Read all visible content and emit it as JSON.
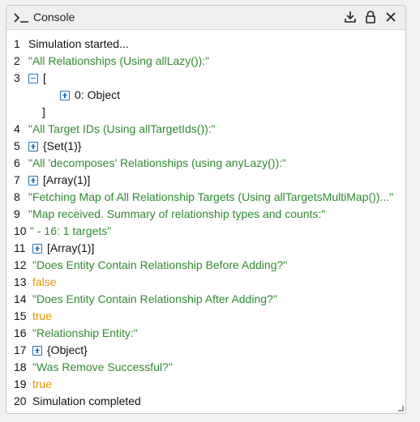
{
  "panel": {
    "title": "Console",
    "icons": [
      "terminal-prompt-icon",
      "download-icon",
      "lock-icon",
      "close-icon"
    ]
  },
  "console": {
    "lines": [
      {
        "num": "1",
        "text": "Simulation started...",
        "kind": "plain"
      },
      {
        "num": "2",
        "text": "\"All Relationships (Using allLazy()):\"",
        "kind": "string"
      },
      {
        "num": "3",
        "text": "[",
        "kind": "plain",
        "toggle": "collapse"
      },
      {
        "num": "",
        "text": "0: Object",
        "kind": "plain",
        "toggle": "expand"
      },
      {
        "num": "",
        "text": "]",
        "kind": "plain"
      },
      {
        "num": "4",
        "text": "\"All Target IDs (Using allTargetIds()):\"",
        "kind": "string"
      },
      {
        "num": "5",
        "text": "{Set(1)}",
        "kind": "plain",
        "toggle": "expand"
      },
      {
        "num": "6",
        "text": "\"All 'decomposes' Relationships (using anyLazy()):\"",
        "kind": "string"
      },
      {
        "num": "7",
        "text": "[Array(1)]",
        "kind": "plain",
        "toggle": "expand"
      },
      {
        "num": "8",
        "text": "\"Fetching Map of All Relationship Targets (Using allTargetsMultiMap())...\"",
        "kind": "string"
      },
      {
        "num": "9",
        "text": "\"Map received. Summary of relationship types and counts:\"",
        "kind": "string"
      },
      {
        "num": "10",
        "text": "\" - 16: 1 targets\"",
        "kind": "string"
      },
      {
        "num": "11",
        "text": "[Array(1)]",
        "kind": "plain",
        "toggle": "expand"
      },
      {
        "num": "12",
        "text": "\"Does Entity Contain Relationship Before Adding?\"",
        "kind": "string"
      },
      {
        "num": "13",
        "text": "false",
        "kind": "boolean"
      },
      {
        "num": "14",
        "text": "\"Does Entity Contain Relationship After Adding?\"",
        "kind": "string"
      },
      {
        "num": "15",
        "text": "true",
        "kind": "boolean"
      },
      {
        "num": "16",
        "text": "\"Relationship Entity:\"",
        "kind": "string"
      },
      {
        "num": "17",
        "text": "{Object}",
        "kind": "plain",
        "toggle": "expand"
      },
      {
        "num": "18",
        "text": "\"Was Remove Successful?\"",
        "kind": "string"
      },
      {
        "num": "19",
        "text": "true",
        "kind": "boolean"
      },
      {
        "num": "20",
        "text": "Simulation completed",
        "kind": "plain"
      }
    ]
  },
  "colors": {
    "string": "#2e8b2e",
    "boolean": "#e59400",
    "toggle": "#1f73b7"
  }
}
